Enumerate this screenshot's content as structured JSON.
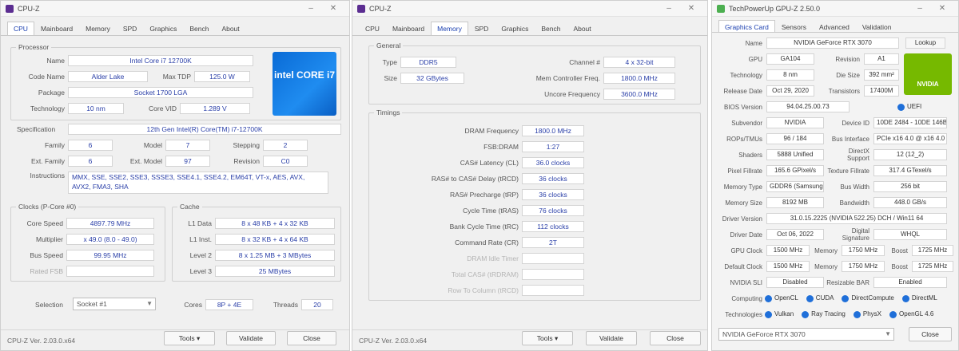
{
  "win1": {
    "title": "CPU-Z",
    "tabs": [
      "CPU",
      "Mainboard",
      "Memory",
      "SPD",
      "Graphics",
      "Bench",
      "About"
    ],
    "active_tab": 0,
    "processor": {
      "label": "Processor",
      "name_label": "Name",
      "name": "Intel Core i7 12700K",
      "codename_label": "Code Name",
      "codename": "Alder Lake",
      "maxtdp_label": "Max TDP",
      "maxtdp": "125.0 W",
      "package_label": "Package",
      "package": "Socket 1700 LGA",
      "technology_label": "Technology",
      "technology": "10 nm",
      "corevid_label": "Core VID",
      "corevid": "1.289 V",
      "logo_text": "intel CORE i7"
    },
    "spec": {
      "label": "Specification",
      "value": "12th Gen Intel(R) Core(TM) i7-12700K",
      "family_label": "Family",
      "family": "6",
      "model_label": "Model",
      "model": "7",
      "stepping_label": "Stepping",
      "stepping": "2",
      "extfamily_label": "Ext. Family",
      "extfamily": "6",
      "extmodel_label": "Ext. Model",
      "extmodel": "97",
      "revision_label": "Revision",
      "revision": "C0",
      "instr_label": "Instructions",
      "instr": "MMX, SSE, SSE2, SSE3, SSSE3, SSE4.1, SSE4.2, EM64T, VT-x, AES, AVX, AVX2, FMA3, SHA"
    },
    "clocks": {
      "label": "Clocks (P-Core #0)",
      "corespeed_label": "Core Speed",
      "corespeed": "4897.79 MHz",
      "multiplier_label": "Multiplier",
      "multiplier": "x 49.0 (8.0 - 49.0)",
      "busspeed_label": "Bus Speed",
      "busspeed": "99.95 MHz",
      "ratedfsb_label": "Rated FSB",
      "ratedfsb": ""
    },
    "cache": {
      "label": "Cache",
      "l1d_label": "L1 Data",
      "l1d": "8 x 48 KB + 4 x 32 KB",
      "l1i_label": "L1 Inst.",
      "l1i": "8 x 32 KB + 4 x 64 KB",
      "l2_label": "Level 2",
      "l2": "8 x 1.25 MB + 3 MBytes",
      "l3_label": "Level 3",
      "l3": "25 MBytes"
    },
    "selection_label": "Selection",
    "selection": "Socket #1",
    "cores_label": "Cores",
    "cores": "8P + 4E",
    "threads_label": "Threads",
    "threads": "20",
    "footer": {
      "version": "CPU-Z  Ver. 2.03.0.x64",
      "tools": "Tools",
      "validate": "Validate",
      "close": "Close"
    }
  },
  "win2": {
    "title": "CPU-Z",
    "tabs": [
      "CPU",
      "Mainboard",
      "Memory",
      "SPD",
      "Graphics",
      "Bench",
      "About"
    ],
    "active_tab": 2,
    "general": {
      "label": "General",
      "type_label": "Type",
      "type": "DDR5",
      "size_label": "Size",
      "size": "32 GBytes",
      "channel_label": "Channel #",
      "channel": "4 x 32-bit",
      "memctrl_label": "Mem Controller Freq.",
      "memctrl": "1800.0 MHz",
      "uncore_label": "Uncore Frequency",
      "uncore": "3600.0 MHz"
    },
    "timings": {
      "label": "Timings",
      "rows": [
        {
          "label": "DRAM Frequency",
          "value": "1800.0 MHz"
        },
        {
          "label": "FSB:DRAM",
          "value": "1:27"
        },
        {
          "label": "CAS# Latency (CL)",
          "value": "36.0 clocks"
        },
        {
          "label": "RAS# to CAS# Delay (tRCD)",
          "value": "36 clocks"
        },
        {
          "label": "RAS# Precharge (tRP)",
          "value": "36 clocks"
        },
        {
          "label": "Cycle Time (tRAS)",
          "value": "76 clocks"
        },
        {
          "label": "Bank Cycle Time (tRC)",
          "value": "112 clocks"
        },
        {
          "label": "Command Rate (CR)",
          "value": "2T"
        },
        {
          "label": "DRAM Idle Timer",
          "value": ""
        },
        {
          "label": "Total CAS# (tRDRAM)",
          "value": ""
        },
        {
          "label": "Row To Column (tRCD)",
          "value": ""
        }
      ]
    },
    "footer": {
      "version": "CPU-Z  Ver. 2.03.0.x64",
      "tools": "Tools",
      "validate": "Validate",
      "close": "Close"
    }
  },
  "win3": {
    "title": "TechPowerUp GPU-Z 2.50.0",
    "tabs": [
      "Graphics Card",
      "Sensors",
      "Advanced",
      "Validation"
    ],
    "rows": [
      {
        "label": "Name",
        "value": "NVIDIA GeForce RTX 3070",
        "lookup": "Lookup"
      },
      {
        "label": "GPU",
        "value": "GA104",
        "label2": "Revision",
        "value2": "A1"
      },
      {
        "label": "Technology",
        "value": "8 nm",
        "label2": "Die Size",
        "value2": "392 mm²"
      },
      {
        "label": "Release Date",
        "value": "Oct 29, 2020",
        "label2": "Transistors",
        "value2": "17400M"
      },
      {
        "label": "BIOS Version",
        "value": "94.04.25.00.73",
        "uefi": "UEFI"
      },
      {
        "label": "Subvendor",
        "value": "NVIDIA",
        "label2": "Device ID",
        "value2": "10DE 2484 - 10DE 146B"
      },
      {
        "label": "ROPs/TMUs",
        "value": "96 / 184",
        "label2": "Bus Interface",
        "value2": "PCIe x16 4.0 @ x16 4.0"
      },
      {
        "label": "Shaders",
        "value": "5888 Unified",
        "label2": "DirectX Support",
        "value2": "12 (12_2)"
      },
      {
        "label": "Pixel Fillrate",
        "value": "165.6 GPixel/s",
        "label2": "Texture Fillrate",
        "value2": "317.4 GTexel/s"
      },
      {
        "label": "Memory Type",
        "value": "GDDR6 (Samsung)",
        "label2": "Bus Width",
        "value2": "256 bit"
      },
      {
        "label": "Memory Size",
        "value": "8192 MB",
        "label2": "Bandwidth",
        "value2": "448.0 GB/s"
      },
      {
        "label": "Driver Version",
        "value": "31.0.15.2225 (NVIDIA 522.25) DCH / Win11 64"
      },
      {
        "label": "Driver Date",
        "value": "Oct 06, 2022",
        "label2": "Digital Signature",
        "value2": "WHQL"
      },
      {
        "label": "GPU Clock",
        "value": "1500 MHz",
        "label2": "Memory",
        "value2": "1750 MHz",
        "label3": "Boost",
        "value3": "1725 MHz"
      },
      {
        "label": "Default Clock",
        "value": "1500 MHz",
        "label2": "Memory",
        "value2": "1750 MHz",
        "label3": "Boost",
        "value3": "1725 MHz"
      },
      {
        "label": "NVIDIA SLI",
        "value": "Disabled",
        "label2": "Resizable BAR",
        "value2": "Enabled"
      }
    ],
    "computing_label": "Computing",
    "computing": [
      "OpenCL",
      "CUDA",
      "DirectCompute",
      "DirectML"
    ],
    "technologies_label": "Technologies",
    "technologies": [
      "Vulkan",
      "Ray Tracing",
      "PhysX",
      "OpenGL 4.6"
    ],
    "bottom_select": "NVIDIA GeForce RTX 3070",
    "close": "Close",
    "logo_text": "NVIDIA"
  }
}
